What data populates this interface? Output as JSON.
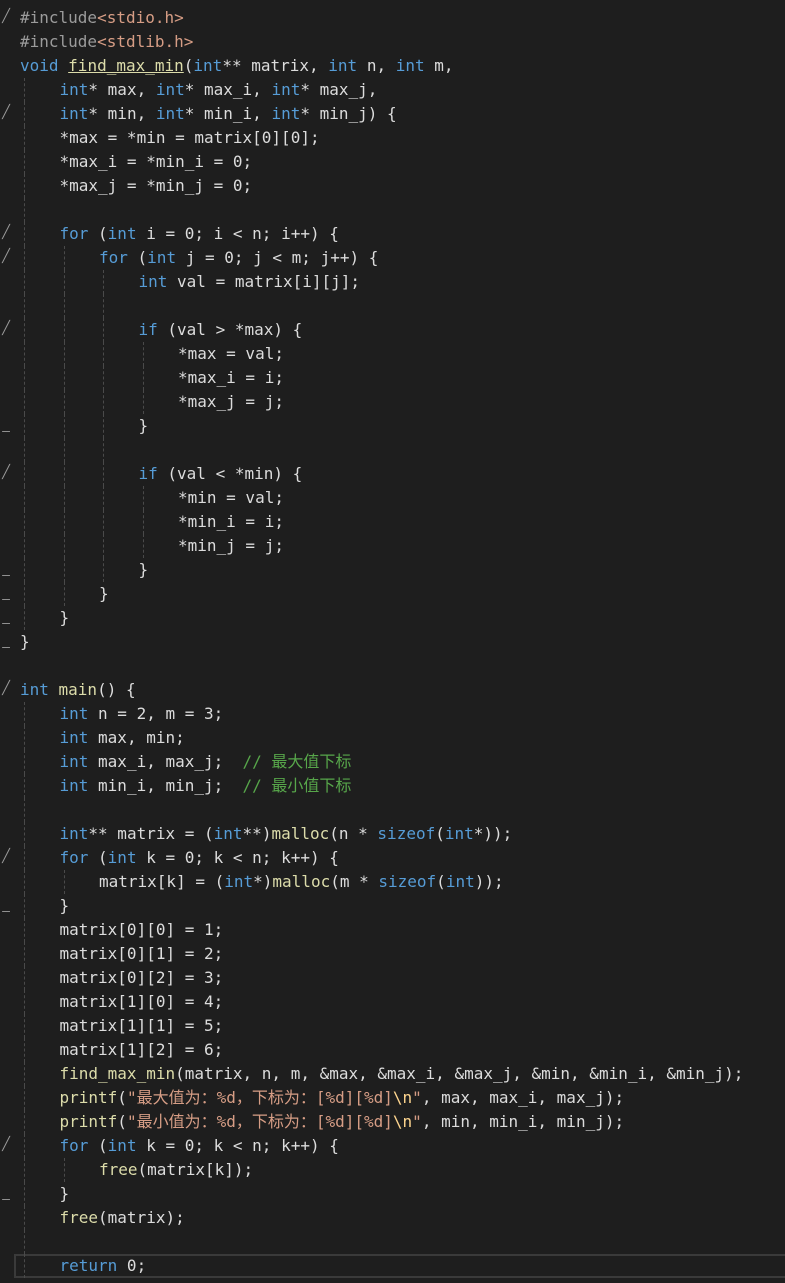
{
  "editor": {
    "colors": {
      "background": "#1e1e1e",
      "keyword": "#569cd6",
      "preprocessor": "#9b9b9b",
      "string": "#d69d85",
      "number": "#b5cea8",
      "comment": "#57a64a",
      "function": "#dcdcaa",
      "variable": "#9cdcfe",
      "plain": "#dcdcdc"
    },
    "lines": [
      {
        "fold": "expanded",
        "indent": 0,
        "tokens": [
          [
            "pp",
            "#include"
          ],
          [
            "str",
            "<stdio.h>"
          ]
        ]
      },
      {
        "fold": "",
        "indent": 0,
        "tokens": [
          [
            "pp",
            "#include"
          ],
          [
            "str",
            "<stdlib.h>"
          ]
        ]
      },
      {
        "fold": "",
        "indent": 0,
        "tokens": [
          [
            "kw",
            "void "
          ],
          [
            "fnu",
            "find_max_min"
          ],
          [
            "plain",
            "("
          ],
          [
            "kw",
            "int"
          ],
          [
            "plain",
            "** matrix, "
          ],
          [
            "kw",
            "int"
          ],
          [
            "plain",
            " n, "
          ],
          [
            "kw",
            "int"
          ],
          [
            "plain",
            " m,"
          ]
        ]
      },
      {
        "fold": "",
        "indent": 1,
        "tokens": [
          [
            "kw",
            "int"
          ],
          [
            "plain",
            "* max, "
          ],
          [
            "kw",
            "int"
          ],
          [
            "plain",
            "* max_i, "
          ],
          [
            "kw",
            "int"
          ],
          [
            "plain",
            "* max_j,"
          ]
        ]
      },
      {
        "fold": "expanded",
        "indent": 1,
        "tokens": [
          [
            "kw",
            "int"
          ],
          [
            "plain",
            "* min, "
          ],
          [
            "kw",
            "int"
          ],
          [
            "plain",
            "* min_i, "
          ],
          [
            "kw",
            "int"
          ],
          [
            "plain",
            "* min_j) {"
          ]
        ]
      },
      {
        "fold": "",
        "indent": 1,
        "tokens": [
          [
            "plain",
            "*max = *min = matrix[0][0];"
          ]
        ]
      },
      {
        "fold": "",
        "indent": 1,
        "tokens": [
          [
            "plain",
            "*max_i = *min_i = 0;"
          ]
        ]
      },
      {
        "fold": "",
        "indent": 1,
        "tokens": [
          [
            "plain",
            "*max_j = *min_j = 0;"
          ]
        ]
      },
      {
        "fold": "",
        "indent": 1,
        "tokens": []
      },
      {
        "fold": "expanded",
        "indent": 1,
        "tokens": [
          [
            "kw",
            "for"
          ],
          [
            "plain",
            " ("
          ],
          [
            "kw",
            "int"
          ],
          [
            "plain",
            " i = 0; i < n; i++) {"
          ]
        ]
      },
      {
        "fold": "expanded",
        "indent": 2,
        "tokens": [
          [
            "kw",
            "for"
          ],
          [
            "plain",
            " ("
          ],
          [
            "kw",
            "int"
          ],
          [
            "plain",
            " j = 0; j < m; j++) {"
          ]
        ]
      },
      {
        "fold": "",
        "indent": 3,
        "tokens": [
          [
            "kw",
            "int"
          ],
          [
            "plain",
            " val = matrix[i][j];"
          ]
        ]
      },
      {
        "fold": "",
        "indent": 3,
        "tokens": []
      },
      {
        "fold": "expanded",
        "indent": 3,
        "tokens": [
          [
            "kw",
            "if"
          ],
          [
            "plain",
            " (val > *max) {"
          ]
        ]
      },
      {
        "fold": "",
        "indent": 4,
        "tokens": [
          [
            "plain",
            "*max = val;"
          ]
        ]
      },
      {
        "fold": "",
        "indent": 4,
        "tokens": [
          [
            "plain",
            "*max_i = i;"
          ]
        ]
      },
      {
        "fold": "",
        "indent": 4,
        "tokens": [
          [
            "plain",
            "*max_j = j;"
          ]
        ]
      },
      {
        "fold": "end",
        "indent": 3,
        "tokens": [
          [
            "plain",
            "}"
          ]
        ]
      },
      {
        "fold": "",
        "indent": 3,
        "tokens": []
      },
      {
        "fold": "expanded",
        "indent": 3,
        "tokens": [
          [
            "kw",
            "if"
          ],
          [
            "plain",
            " (val < *min) {"
          ]
        ]
      },
      {
        "fold": "",
        "indent": 4,
        "tokens": [
          [
            "plain",
            "*min = val;"
          ]
        ]
      },
      {
        "fold": "",
        "indent": 4,
        "tokens": [
          [
            "plain",
            "*min_i = i;"
          ]
        ]
      },
      {
        "fold": "",
        "indent": 4,
        "tokens": [
          [
            "plain",
            "*min_j = j;"
          ]
        ]
      },
      {
        "fold": "end",
        "indent": 3,
        "tokens": [
          [
            "plain",
            "}"
          ]
        ]
      },
      {
        "fold": "end",
        "indent": 2,
        "tokens": [
          [
            "plain",
            "}"
          ]
        ]
      },
      {
        "fold": "end",
        "indent": 1,
        "tokens": [
          [
            "plain",
            "}"
          ]
        ]
      },
      {
        "fold": "end",
        "indent": 0,
        "tokens": [
          [
            "plain",
            "}"
          ]
        ]
      },
      {
        "fold": "",
        "indent": 0,
        "tokens": []
      },
      {
        "fold": "expanded",
        "indent": 0,
        "tokens": [
          [
            "kw",
            "int "
          ],
          [
            "fn",
            "main"
          ],
          [
            "plain",
            "() {"
          ]
        ]
      },
      {
        "fold": "",
        "indent": 1,
        "tokens": [
          [
            "kw",
            "int"
          ],
          [
            "plain",
            " n = 2, m = 3;"
          ]
        ]
      },
      {
        "fold": "",
        "indent": 1,
        "tokens": [
          [
            "kw",
            "int"
          ],
          [
            "plain",
            " max, min;"
          ]
        ]
      },
      {
        "fold": "",
        "indent": 1,
        "tokens": [
          [
            "kw",
            "int"
          ],
          [
            "plain",
            " max_i, max_j;  "
          ],
          [
            "cm",
            "// 最大值下标"
          ]
        ]
      },
      {
        "fold": "",
        "indent": 1,
        "tokens": [
          [
            "kw",
            "int"
          ],
          [
            "plain",
            " min_i, min_j;  "
          ],
          [
            "cm",
            "// 最小值下标"
          ]
        ]
      },
      {
        "fold": "",
        "indent": 1,
        "tokens": []
      },
      {
        "fold": "",
        "indent": 1,
        "tokens": [
          [
            "kw",
            "int"
          ],
          [
            "plain",
            "** matrix = ("
          ],
          [
            "kw",
            "int"
          ],
          [
            "plain",
            "**)"
          ],
          [
            "fn",
            "malloc"
          ],
          [
            "plain",
            "(n * "
          ],
          [
            "kw",
            "sizeof"
          ],
          [
            "plain",
            "("
          ],
          [
            "kw",
            "int"
          ],
          [
            "plain",
            "*));"
          ]
        ]
      },
      {
        "fold": "expanded",
        "indent": 1,
        "tokens": [
          [
            "kw",
            "for"
          ],
          [
            "plain",
            " ("
          ],
          [
            "kw",
            "int"
          ],
          [
            "plain",
            " k = 0; k < n; k++) {"
          ]
        ]
      },
      {
        "fold": "",
        "indent": 2,
        "tokens": [
          [
            "plain",
            "matrix[k] = ("
          ],
          [
            "kw",
            "int"
          ],
          [
            "plain",
            "*)"
          ],
          [
            "fn",
            "malloc"
          ],
          [
            "plain",
            "(m * "
          ],
          [
            "kw",
            "sizeof"
          ],
          [
            "plain",
            "("
          ],
          [
            "kw",
            "int"
          ],
          [
            "plain",
            "));"
          ]
        ]
      },
      {
        "fold": "end",
        "indent": 1,
        "tokens": [
          [
            "plain",
            "}"
          ]
        ]
      },
      {
        "fold": "",
        "indent": 1,
        "tokens": [
          [
            "plain",
            "matrix[0][0] = 1;"
          ]
        ]
      },
      {
        "fold": "",
        "indent": 1,
        "tokens": [
          [
            "plain",
            "matrix[0][1] = 2;"
          ]
        ]
      },
      {
        "fold": "",
        "indent": 1,
        "tokens": [
          [
            "plain",
            "matrix[0][2] = 3;"
          ]
        ]
      },
      {
        "fold": "",
        "indent": 1,
        "tokens": [
          [
            "plain",
            "matrix[1][0] = 4;"
          ]
        ]
      },
      {
        "fold": "",
        "indent": 1,
        "tokens": [
          [
            "plain",
            "matrix[1][1] = 5;"
          ]
        ]
      },
      {
        "fold": "",
        "indent": 1,
        "tokens": [
          [
            "plain",
            "matrix[1][2] = 6;"
          ]
        ]
      },
      {
        "fold": "",
        "indent": 1,
        "tokens": [
          [
            "fn",
            "find_max_min"
          ],
          [
            "plain",
            "(matrix, n, m, &max, &max_i, &max_j, &min, &min_i, &min_j);"
          ]
        ]
      },
      {
        "fold": "",
        "indent": 1,
        "tokens": [
          [
            "fn",
            "printf"
          ],
          [
            "plain",
            "("
          ],
          [
            "str",
            "\"最大值为：%d，下标为：[%d][%d]"
          ],
          [
            "esc",
            "\\n"
          ],
          [
            "str",
            "\""
          ],
          [
            "plain",
            ", max, max_i, max_j);"
          ]
        ]
      },
      {
        "fold": "",
        "indent": 1,
        "tokens": [
          [
            "fn",
            "printf"
          ],
          [
            "plain",
            "("
          ],
          [
            "str",
            "\"最小值为：%d，下标为：[%d][%d]"
          ],
          [
            "esc",
            "\\n"
          ],
          [
            "str",
            "\""
          ],
          [
            "plain",
            ", min, min_i, min_j);"
          ]
        ]
      },
      {
        "fold": "expanded",
        "indent": 1,
        "tokens": [
          [
            "kw",
            "for"
          ],
          [
            "plain",
            " ("
          ],
          [
            "kw",
            "int"
          ],
          [
            "plain",
            " k = 0; k < n; k++) {"
          ]
        ]
      },
      {
        "fold": "",
        "indent": 2,
        "tokens": [
          [
            "fn",
            "free"
          ],
          [
            "plain",
            "(matrix[k]);"
          ]
        ]
      },
      {
        "fold": "end",
        "indent": 1,
        "tokens": [
          [
            "plain",
            "}"
          ]
        ]
      },
      {
        "fold": "",
        "indent": 1,
        "tokens": [
          [
            "fn",
            "free"
          ],
          [
            "plain",
            "(matrix);"
          ]
        ]
      },
      {
        "fold": "",
        "indent": 1,
        "tokens": []
      },
      {
        "fold": "",
        "indent": 1,
        "current": true,
        "tokens": [
          [
            "kw",
            "return"
          ],
          [
            "plain",
            " 0;"
          ]
        ]
      }
    ]
  }
}
